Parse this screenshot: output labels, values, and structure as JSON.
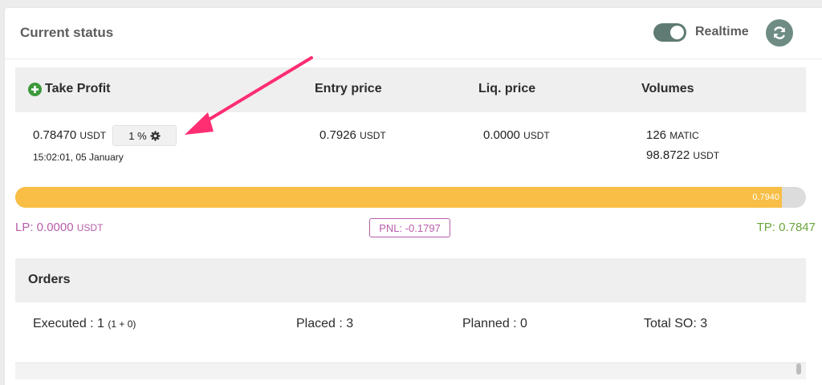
{
  "header": {
    "title": "Current status",
    "realtime_label": "Realtime",
    "realtime_on": true,
    "accent_color": "#5f7b73"
  },
  "columns": {
    "take_profit": "Take Profit",
    "entry_price": "Entry price",
    "liq_price": "Liq. price",
    "volumes": "Volumes"
  },
  "row": {
    "take_profit_value": "0.78470",
    "take_profit_unit": "USDT",
    "take_profit_pct": "1 %",
    "take_profit_time": "15:02:01, 05 January",
    "entry_value": "0.7926",
    "entry_unit": "USDT",
    "liq_value": "0.0000",
    "liq_unit": "USDT",
    "volume_coin_value": "126",
    "volume_coin_unit": "MATIC",
    "volume_usdt_value": "98.8722",
    "volume_usdt_unit": "USDT"
  },
  "progress": {
    "fill_percent": 97,
    "label": "0.7940",
    "fill_color": "#f8be45"
  },
  "metrics": {
    "lp_label": "LP: 0.0000",
    "lp_unit": "USDT",
    "pnl_label": "PNL: -0.1797",
    "tp_label": "TP: 0.7847",
    "lp_color": "#b65eaa",
    "tp_color": "#6aa53a"
  },
  "orders": {
    "title": "Orders",
    "executed_label": "Executed : 1",
    "executed_detail": "(1 + 0)",
    "placed_label": "Placed : 3",
    "planned_label": "Planned : 0",
    "total_so_label": "Total SO: 3"
  }
}
